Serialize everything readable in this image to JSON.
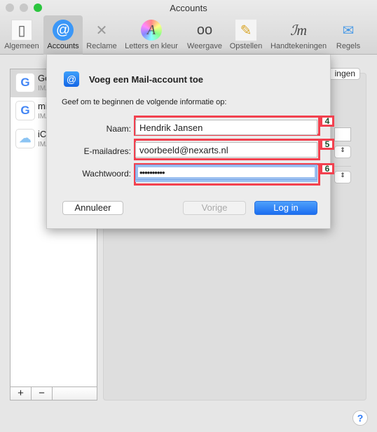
{
  "window": {
    "title": "Accounts"
  },
  "toolbar": [
    {
      "label": "Algemeen",
      "icon": "switch-icon"
    },
    {
      "label": "Accounts",
      "icon": "at-icon",
      "selected": true
    },
    {
      "label": "Reclame",
      "icon": "trash-icon"
    },
    {
      "label": "Letters en kleur",
      "icon": "font-color-icon"
    },
    {
      "label": "Weergave",
      "icon": "glasses-icon"
    },
    {
      "label": "Opstellen",
      "icon": "pencil-icon"
    },
    {
      "label": "Handtekeningen",
      "icon": "signature-icon"
    },
    {
      "label": "Regels",
      "icon": "rules-icon"
    }
  ],
  "sidebar": {
    "accounts": [
      {
        "name": "Go",
        "sub": "IMA",
        "icon": "google-icon",
        "selected": true
      },
      {
        "name": "mi",
        "sub": "IMA",
        "icon": "google-icon"
      },
      {
        "name": "iCl",
        "sub": "IMA",
        "icon": "icloud-icon"
      }
    ],
    "add": "+",
    "remove": "−"
  },
  "panel": {
    "partial_button": "ingen"
  },
  "help": "?",
  "sheet": {
    "title": "Voeg een Mail-account toe",
    "subtitle": "Geef om te beginnen de volgende informatie op:",
    "fields": [
      {
        "label": "Naam:",
        "value": "Hendrik Jansen",
        "badge": "4"
      },
      {
        "label": "E-mailadres:",
        "value": "voorbeeld@nexarts.nl",
        "badge": "5"
      },
      {
        "label": "Wachtwoord:",
        "value": "••••••••••",
        "badge": "6"
      }
    ],
    "cancel": "Annuleer",
    "back": "Vorige",
    "login": "Log in"
  },
  "colors": {
    "accent": "#1f72f0",
    "highlight": "#f2414f"
  }
}
